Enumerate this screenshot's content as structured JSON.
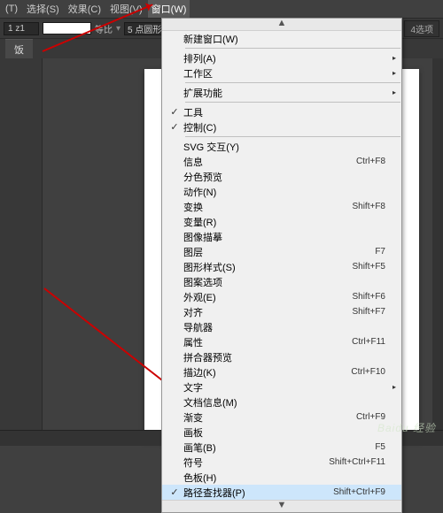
{
  "menubar": {
    "items": [
      "(T)",
      "选择(S)",
      "效果(C)",
      "视图(V)",
      "窗口(W)"
    ]
  },
  "toolbar": {
    "zoom": "1 z1",
    "stroke_label": "等比",
    "points": "5 点圆形",
    "option": "4选项"
  },
  "tab": {
    "title": "饭"
  },
  "menu": {
    "scroll_up": "▲",
    "scroll_down": "▼",
    "arrow": "▸",
    "check": "✓",
    "sections": [
      {
        "items": [
          {
            "label": "新建窗口(W)",
            "shortcut": "",
            "sub": false,
            "checked": false
          }
        ]
      },
      {
        "items": [
          {
            "label": "排列(A)",
            "shortcut": "",
            "sub": true,
            "checked": false
          },
          {
            "label": "工作区",
            "shortcut": "",
            "sub": true,
            "checked": false
          }
        ]
      },
      {
        "items": [
          {
            "label": "扩展功能",
            "shortcut": "",
            "sub": true,
            "checked": false
          }
        ]
      },
      {
        "items": [
          {
            "label": "工具",
            "shortcut": "",
            "sub": false,
            "checked": true
          },
          {
            "label": "控制(C)",
            "shortcut": "",
            "sub": false,
            "checked": true
          }
        ]
      },
      {
        "items": [
          {
            "label": "SVG 交互(Y)",
            "shortcut": "",
            "sub": false,
            "checked": false
          },
          {
            "label": "信息",
            "shortcut": "Ctrl+F8",
            "sub": false,
            "checked": false
          },
          {
            "label": "分色预览",
            "shortcut": "",
            "sub": false,
            "checked": false
          },
          {
            "label": "动作(N)",
            "shortcut": "",
            "sub": false,
            "checked": false
          },
          {
            "label": "变换",
            "shortcut": "Shift+F8",
            "sub": false,
            "checked": false
          },
          {
            "label": "变量(R)",
            "shortcut": "",
            "sub": false,
            "checked": false
          },
          {
            "label": "图像描摹",
            "shortcut": "",
            "sub": false,
            "checked": false
          },
          {
            "label": "图层",
            "shortcut": "F7",
            "sub": false,
            "checked": false
          },
          {
            "label": "图形样式(S)",
            "shortcut": "Shift+F5",
            "sub": false,
            "checked": false
          },
          {
            "label": "图案选项",
            "shortcut": "",
            "sub": false,
            "checked": false
          },
          {
            "label": "外观(E)",
            "shortcut": "Shift+F6",
            "sub": false,
            "checked": false
          },
          {
            "label": "对齐",
            "shortcut": "Shift+F7",
            "sub": false,
            "checked": false
          },
          {
            "label": "导航器",
            "shortcut": "",
            "sub": false,
            "checked": false
          },
          {
            "label": "属性",
            "shortcut": "Ctrl+F11",
            "sub": false,
            "checked": false
          },
          {
            "label": "拼合器预览",
            "shortcut": "",
            "sub": false,
            "checked": false
          },
          {
            "label": "描边(K)",
            "shortcut": "Ctrl+F10",
            "sub": false,
            "checked": false
          },
          {
            "label": "文字",
            "shortcut": "",
            "sub": true,
            "checked": false
          },
          {
            "label": "文档信息(M)",
            "shortcut": "",
            "sub": false,
            "checked": false
          },
          {
            "label": "渐变",
            "shortcut": "Ctrl+F9",
            "sub": false,
            "checked": false
          },
          {
            "label": "画板",
            "shortcut": "",
            "sub": false,
            "checked": false
          },
          {
            "label": "画笔(B)",
            "shortcut": "F5",
            "sub": false,
            "checked": false
          },
          {
            "label": "符号",
            "shortcut": "Shift+Ctrl+F11",
            "sub": false,
            "checked": false
          },
          {
            "label": "色板(H)",
            "shortcut": "",
            "sub": false,
            "checked": false
          },
          {
            "label": "路径查找器(P)",
            "shortcut": "Shift+Ctrl+F9",
            "sub": false,
            "checked": true,
            "hl": true
          }
        ]
      }
    ]
  },
  "watermark": "Baidu 经验"
}
